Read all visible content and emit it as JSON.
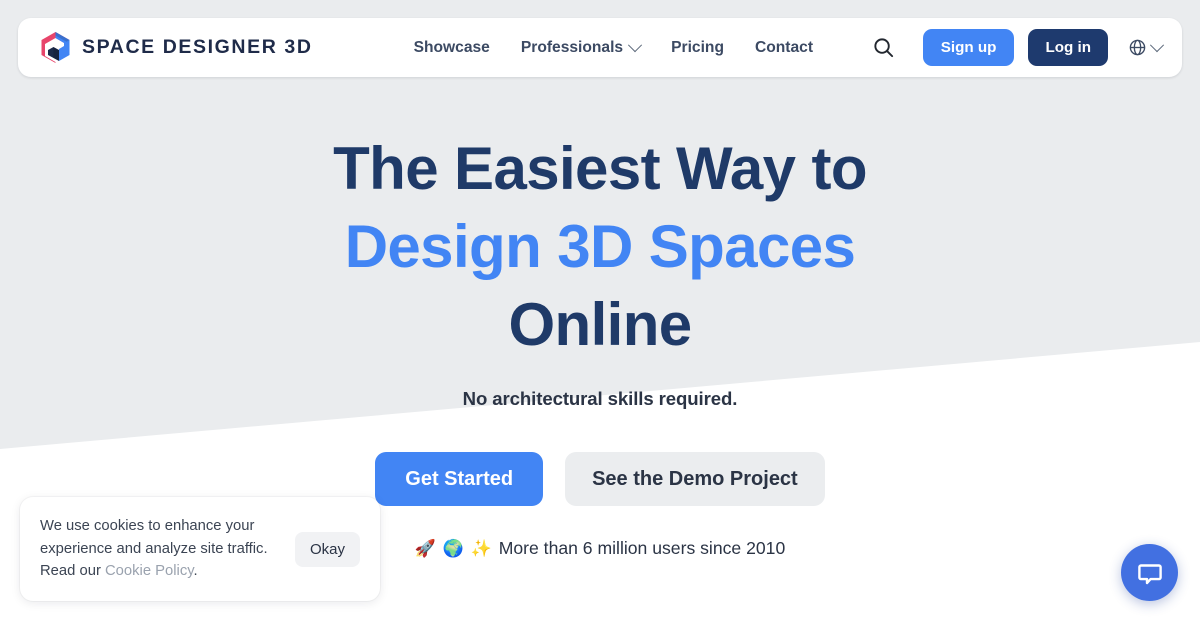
{
  "brand": {
    "name": "SPACE DESIGNER 3D",
    "logo_icon": "hexagon-house-logo-icon",
    "colors": {
      "left": "#e8456b",
      "right": "#4285f4",
      "dark": "#1b2a4a"
    }
  },
  "header": {
    "nav": [
      {
        "label": "Showcase",
        "has_dropdown": false
      },
      {
        "label": "Professionals",
        "has_dropdown": true
      },
      {
        "label": "Pricing",
        "has_dropdown": false
      },
      {
        "label": "Contact",
        "has_dropdown": false
      }
    ],
    "search_icon": "search-icon",
    "signup_label": "Sign up",
    "login_label": "Log in",
    "language_icon": "globe-icon",
    "language_chevron_icon": "chevron-down-icon"
  },
  "hero": {
    "title_line1": "The Easiest Way to",
    "title_line2": "Design 3D Spaces",
    "title_line3": "Online",
    "subtitle": "No architectural skills required.",
    "cta_primary": "Get Started",
    "cta_secondary": "See the Demo Project",
    "stat_emoji": "🚀 🌍 ✨",
    "stat_text": "More than 6 million users since 2010"
  },
  "cookie": {
    "text_part1": "We use cookies to enhance your experience and analyze site traffic. Read our ",
    "policy_link": "Cookie Policy",
    "text_part2": ".",
    "accept_label": "Okay"
  },
  "chat": {
    "icon": "chat-bubble-icon",
    "color": "#4270e1"
  },
  "theme": {
    "page_background": "#ffffff",
    "hero_background": "#eaecee",
    "accent_blue": "#4285f4",
    "navy": "#1e3a6e",
    "heading_navy": "#1f3a68"
  }
}
